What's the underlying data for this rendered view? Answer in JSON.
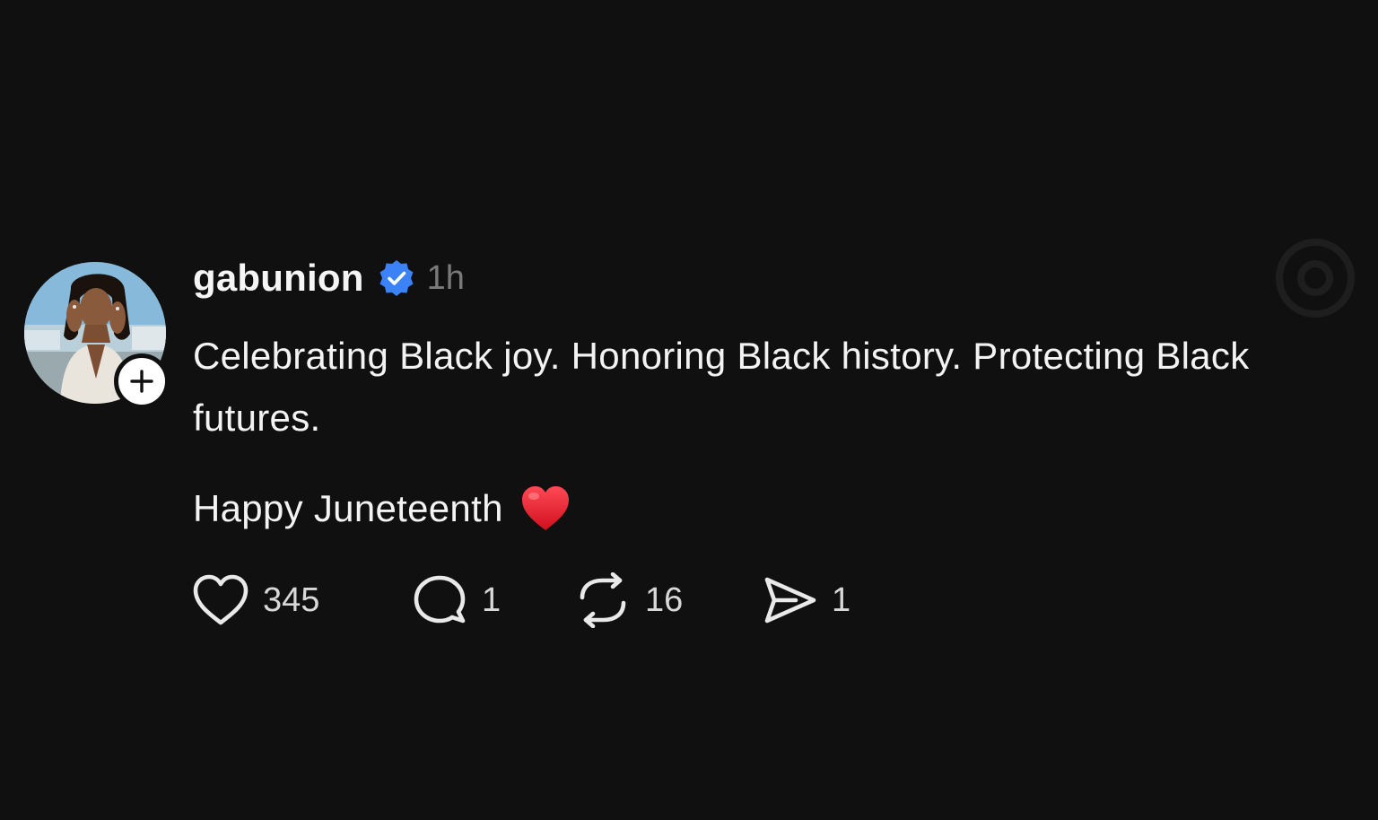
{
  "post": {
    "username": "gabunion",
    "verified": true,
    "timestamp": "1h",
    "body_line1": "Celebrating Black joy. Honoring Black history. Protecting Black futures.",
    "body_line2": "Happy Juneteenth",
    "emoji": "red-heart"
  },
  "actions": {
    "likes": "345",
    "replies": "1",
    "reposts": "16",
    "shares": "1"
  },
  "colors": {
    "background": "#101010",
    "text": "#f3f3f3",
    "muted": "#7a7a7a",
    "verified": "#3b82f6",
    "heart": "#e0202e"
  },
  "icons": {
    "follow": "plus-icon",
    "verified": "verified-badge-icon",
    "like": "heart-outline-icon",
    "reply": "speech-bubble-icon",
    "repost": "repost-arrows-icon",
    "share": "send-plane-icon"
  }
}
